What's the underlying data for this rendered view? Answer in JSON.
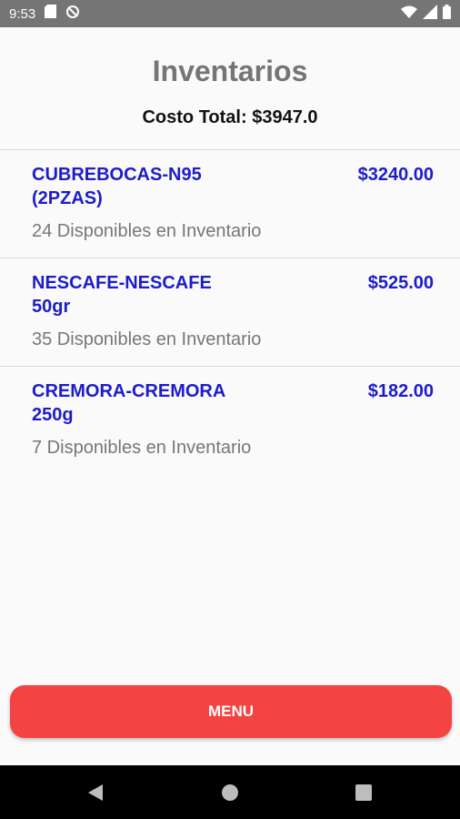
{
  "status_bar": {
    "time": "9:53",
    "left_icons": [
      "sd-card-icon",
      "sync-disabled-icon"
    ],
    "right_icons": [
      "wifi-icon",
      "signal-icon",
      "battery-icon"
    ]
  },
  "header": {
    "title": "Inventarios",
    "total": "Costo Total: $3947.0"
  },
  "items": [
    {
      "name": "CUBREBOCAS-N95 (2PZAS)",
      "price": "$3240.00",
      "stock": "24 Disponibles en Inventario"
    },
    {
      "name": "NESCAFE-NESCAFE 50gr",
      "price": "$525.00",
      "stock": "35 Disponibles en Inventario"
    },
    {
      "name": "CREMORA-CREMORA 250g",
      "price": "$182.00",
      "stock": "7 Disponibles en Inventario"
    }
  ],
  "menu_button": {
    "label": "MENU"
  },
  "nav_bar": {
    "icons": [
      "back-icon",
      "home-icon",
      "recents-icon"
    ]
  },
  "colors": {
    "accent": "#f44343",
    "item_text": "#1c1ccc",
    "title": "#757575",
    "status_bar": "#757575"
  }
}
